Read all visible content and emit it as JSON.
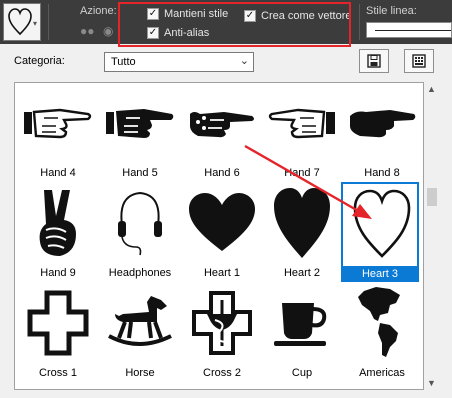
{
  "toolbar": {
    "azione_label": "Azione:",
    "mantieni_stile": "Mantieni stile",
    "anti_alias": "Anti-alias",
    "crea_vettore": "Crea come vettore",
    "stile_linea": "Stile linea:",
    "mantieni_checked": true,
    "anti_alias_checked": true,
    "crea_checked": true
  },
  "category": {
    "label": "Categoria:",
    "value": "Tutto"
  },
  "shapes": [
    {
      "label": "Hand 4",
      "icon": "pointing-hand-4-icon"
    },
    {
      "label": "Hand 5",
      "icon": "pointing-hand-5-icon"
    },
    {
      "label": "Hand 6",
      "icon": "pointing-hand-6-icon"
    },
    {
      "label": "Hand 7",
      "icon": "pointing-hand-7-icon"
    },
    {
      "label": "Hand 8",
      "icon": "pointing-hand-8-icon"
    },
    {
      "label": "Hand 9",
      "icon": "victory-hand-icon"
    },
    {
      "label": "Headphones",
      "icon": "headphones-icon"
    },
    {
      "label": "Heart 1",
      "icon": "heart-filled-icon"
    },
    {
      "label": "Heart 2",
      "icon": "heart-tall-icon"
    },
    {
      "label": "Heart 3",
      "icon": "heart-outline-icon"
    },
    {
      "label": "Cross 1",
      "icon": "cross-outline-icon"
    },
    {
      "label": "Horse",
      "icon": "rocking-horse-icon"
    },
    {
      "label": "Cross 2",
      "icon": "medical-cross-icon"
    },
    {
      "label": "Cup",
      "icon": "cup-icon"
    },
    {
      "label": "Americas",
      "icon": "americas-map-icon"
    }
  ],
  "selected_shape": "Heart 3",
  "colors": {
    "toolbar_bg": "#3c3c3c",
    "highlight": "#e5242a",
    "selection": "#0a7ad4"
  }
}
